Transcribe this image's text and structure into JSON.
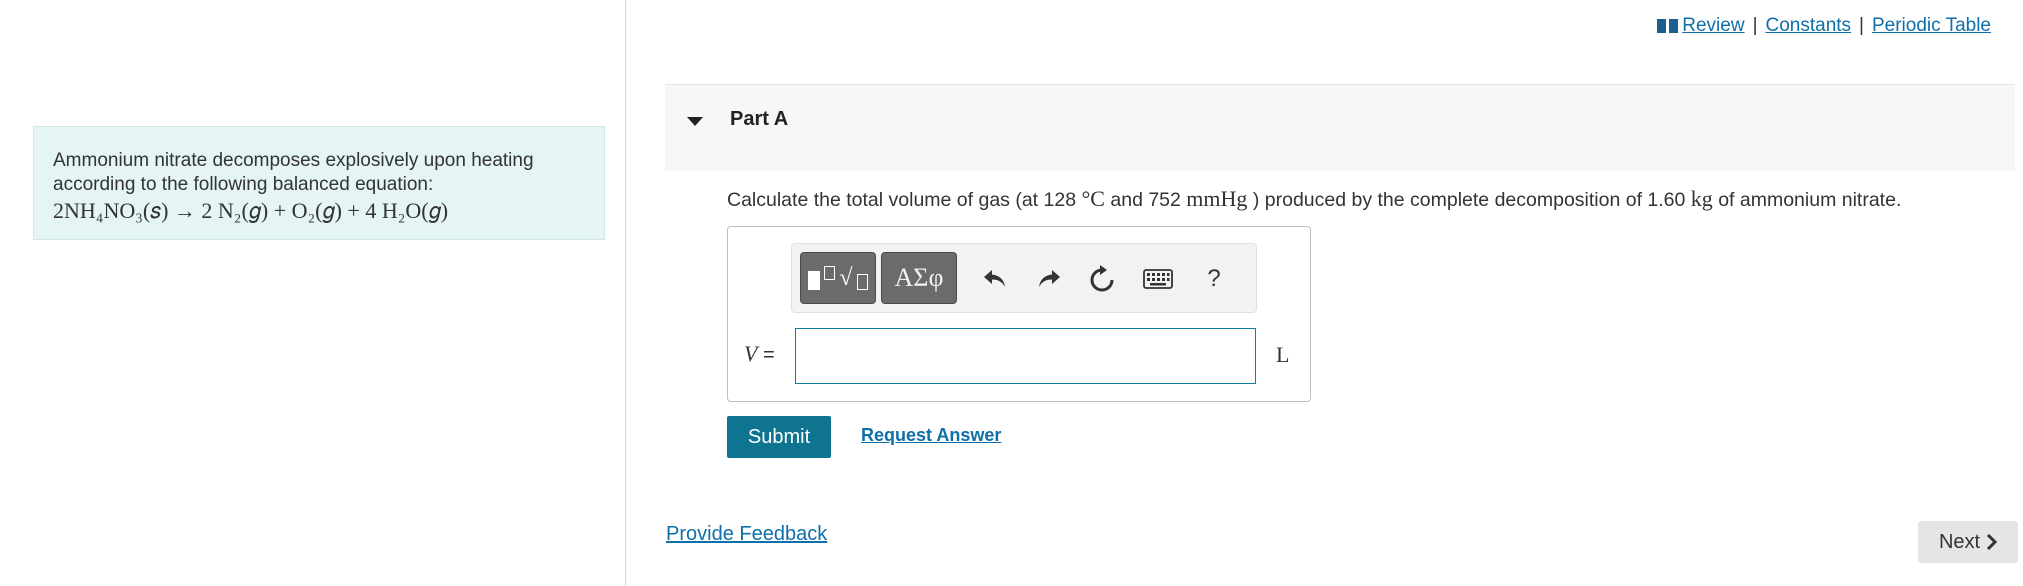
{
  "top_links": {
    "review": "Review",
    "constants": "Constants",
    "periodic_table": "Periodic Table",
    "separator": "|"
  },
  "intro": {
    "text": "Ammonium nitrate decomposes explosively upon heating according to the following balanced equation:",
    "equation": "2NH₄NO₃(𝑠) → 2 N₂(𝑔) + O₂(𝑔) + 4 H₂O(𝑔)"
  },
  "part": {
    "title": "Part A"
  },
  "question": {
    "prefix": "Calculate the total volume of gas (at 128",
    "temp_unit": "°C",
    "and": "and 752",
    "pressure_unit": "mmHg",
    "middle": ") produced by the complete decomposition of 1.60",
    "mass_unit": "kg",
    "suffix": "of ammonium nitrate."
  },
  "toolbar": {
    "greek_label": "ΑΣφ",
    "help_label": "?"
  },
  "answer": {
    "variable": "V",
    "equals": "=",
    "value": "",
    "unit": "L"
  },
  "actions": {
    "submit": "Submit",
    "request_answer": "Request Answer",
    "provide_feedback": "Provide Feedback",
    "next": "Next"
  },
  "colors": {
    "link": "#0f6fa8",
    "submit_bg": "#0e7490",
    "intro_bg": "#e4f5f4",
    "input_border": "#10809a"
  }
}
